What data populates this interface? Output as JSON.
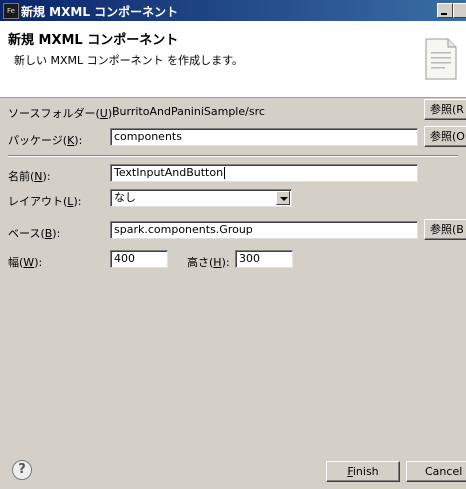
{
  "window": {
    "app_icon": "Fe",
    "title": "新規 MXML コンポーネント"
  },
  "banner": {
    "title": "新規 MXML コンポーネント",
    "description": "新しい MXML コンポーネント を作成します。",
    "icon": "document-icon"
  },
  "form": {
    "source_folder": {
      "label": "ソースフォルダー(",
      "key": "U",
      "label_end": "):",
      "value": "BurritoAndPaniniSample/src",
      "browse_label": "参照(R"
    },
    "package": {
      "label": "パッケージ(",
      "key": "K",
      "label_end": "):",
      "value": "components",
      "browse_label": "参照(O"
    },
    "name": {
      "label": "名前(",
      "key": "N",
      "label_end": "):",
      "value": "TextInputAndButton"
    },
    "layout": {
      "label": "レイアウト(",
      "key": "L",
      "label_end": "):",
      "value": "なし"
    },
    "base": {
      "label": "ベース(",
      "key": "B",
      "label_end": "):",
      "value": "spark.components.Group",
      "browse_label": "参照(B"
    },
    "width": {
      "label": "幅(",
      "key": "W",
      "label_end": "):",
      "value": "400"
    },
    "height": {
      "label": "高さ(",
      "key": "H",
      "label_end": "):",
      "value": "300"
    }
  },
  "footer": {
    "help_label": "?",
    "finish_label": "inish",
    "finish_key": "F",
    "cancel_label": "Cancel"
  }
}
